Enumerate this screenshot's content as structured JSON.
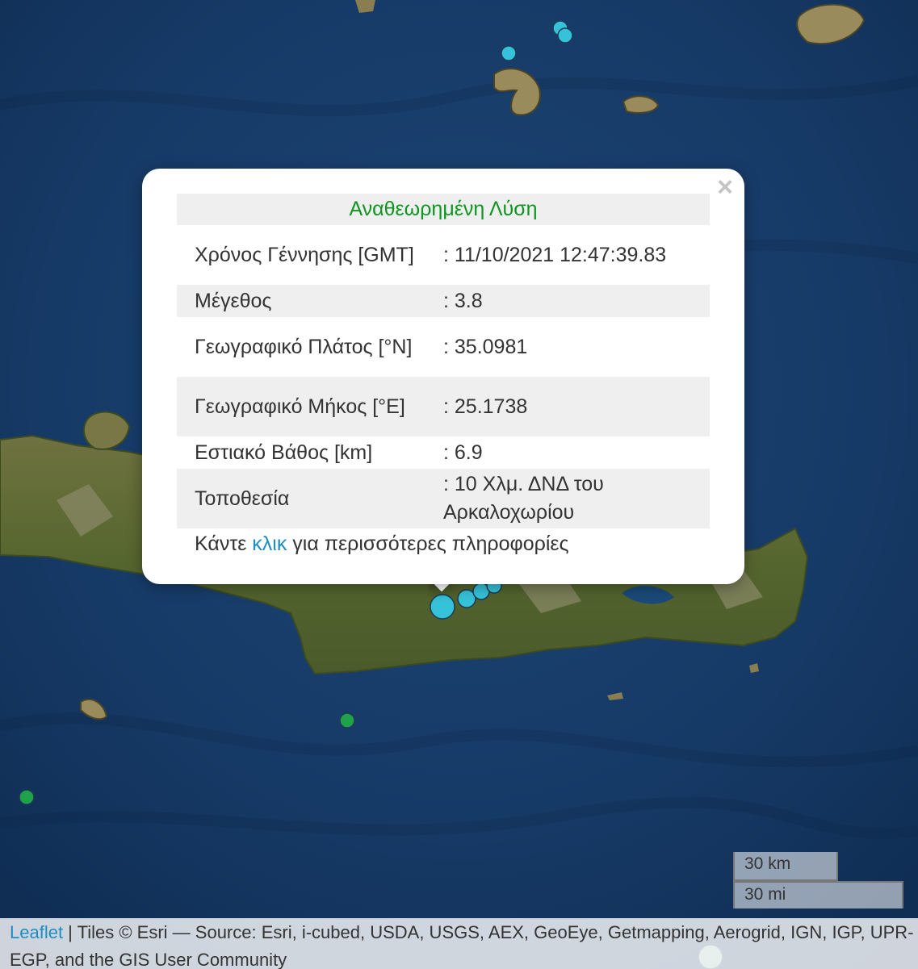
{
  "popup": {
    "close_symbol": "×",
    "title": "Αναθεωρημένη Λύση",
    "rows": [
      {
        "label": "Χρόνος Γέννησης [GMT]",
        "value": ": 11/10/2021 12:47:39.83"
      },
      {
        "label": "Μέγεθος",
        "value": ": 3.8"
      },
      {
        "label": "Γεωγραφικό Πλάτος [°N]",
        "value": ": 35.0981"
      },
      {
        "label": "Γεωγραφικό Μήκος [°E]",
        "value": ": 25.1738"
      },
      {
        "label": "Εστιακό Βάθος [km]",
        "value": ": 6.9"
      },
      {
        "label": "Τοποθεσία",
        "value": ": 10 Χλμ. ΔΝΔ του Αρκαλοχωρίου"
      }
    ],
    "footer": {
      "prefix": "Κάντε ",
      "link": "κλικ",
      "suffix": " για περισσότερες πληροφορίες"
    }
  },
  "scale": {
    "km": "30 km",
    "mi": "30 mi"
  },
  "attribution": {
    "leaflet": "Leaflet",
    "text": " | Tiles © Esri — Source: Esri, i-cubed, USDA, USGS, AEX, GeoEye, Getmapping, Aerogrid, IGN, IGP, UPR-EGP, and the GIS User Community"
  },
  "colors": {
    "sea": "#163a66",
    "land": "#5e6a36",
    "marker_recent": "#36c3d9",
    "marker_older": "#1fa24a",
    "title_green": "#0e9620",
    "link_blue": "#1e8dc4"
  },
  "icons": {
    "close": "close-icon",
    "marker": "earthquake-marker-icon"
  }
}
